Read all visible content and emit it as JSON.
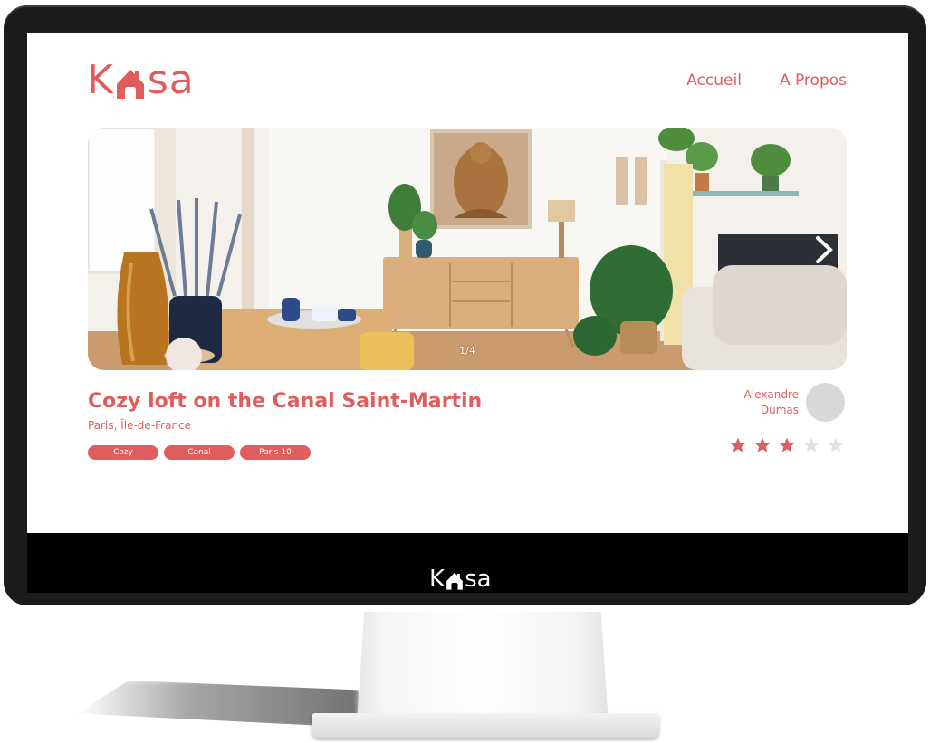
{
  "brand": {
    "logo_left": "K",
    "logo_right": "sa",
    "accent_color": "#e05d5d"
  },
  "nav": {
    "items": [
      {
        "label": "Accueil"
      },
      {
        "label": "A Propos"
      }
    ]
  },
  "carousel": {
    "counter": "1/4",
    "current_index": 1,
    "total": 4,
    "prev_icon": "chevron-left-icon",
    "next_icon": "chevron-right-icon"
  },
  "listing": {
    "title": "Cozy loft on the Canal Saint-Martin",
    "location": "Paris, Île-de-France",
    "tags": [
      {
        "label": "Cozy"
      },
      {
        "label": "Canal"
      },
      {
        "label": "Paris 10"
      }
    ],
    "host": {
      "first_name": "Alexandre",
      "last_name": "Dumas"
    },
    "rating": {
      "value": 3,
      "max": 5
    }
  },
  "footer": {
    "logo_left": "K",
    "logo_right": "sa"
  }
}
